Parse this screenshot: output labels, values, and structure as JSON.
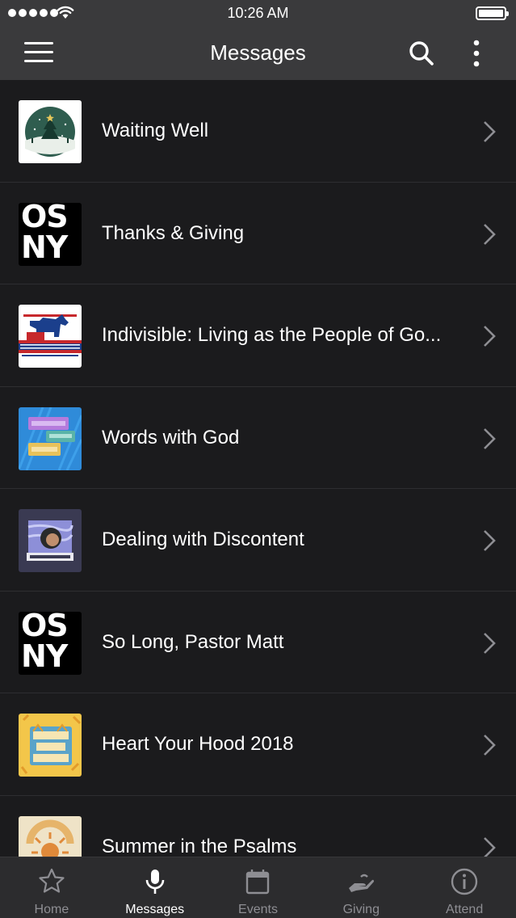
{
  "status_bar": {
    "time": "10:26 AM"
  },
  "nav": {
    "title": "Messages",
    "icons": [
      "menu-icon",
      "search-icon",
      "more-vertical-icon"
    ]
  },
  "messages": [
    {
      "title": "Waiting Well",
      "thumb_icon": "winter-tree-artwork"
    },
    {
      "title": "Thanks & Giving",
      "thumb_icon": "osny-logo",
      "thumb_text": [
        "OS",
        "NY"
      ]
    },
    {
      "title": "Indivisible: Living as the People of Go...",
      "thumb_icon": "donkey-artwork"
    },
    {
      "title": "Words with God",
      "thumb_icon": "words-with-god-artwork"
    },
    {
      "title": "Dealing with Discontent",
      "thumb_icon": "discontent-artwork"
    },
    {
      "title": "So Long, Pastor Matt",
      "thumb_icon": "osny-logo",
      "thumb_text": [
        "OS",
        "NY"
      ]
    },
    {
      "title": "Heart Your Hood 2018",
      "thumb_icon": "heart-your-hood-artwork"
    },
    {
      "title": "Summer in the Psalms",
      "thumb_icon": "summer-psalms-artwork"
    }
  ],
  "tabs": [
    {
      "label": "Home",
      "icon": "star-icon",
      "active": false
    },
    {
      "label": "Messages",
      "icon": "microphone-icon",
      "active": true
    },
    {
      "label": "Events",
      "icon": "calendar-icon",
      "active": false
    },
    {
      "label": "Giving",
      "icon": "giving-hand-icon",
      "active": false
    },
    {
      "label": "Attend",
      "icon": "info-icon",
      "active": false
    }
  ],
  "colors": {
    "background": "#1b1b1d",
    "bar": "#3a3a3c",
    "tab_bar": "#2c2c2e",
    "tab_inactive": "#8e8e93",
    "tab_active": "#ffffff"
  }
}
